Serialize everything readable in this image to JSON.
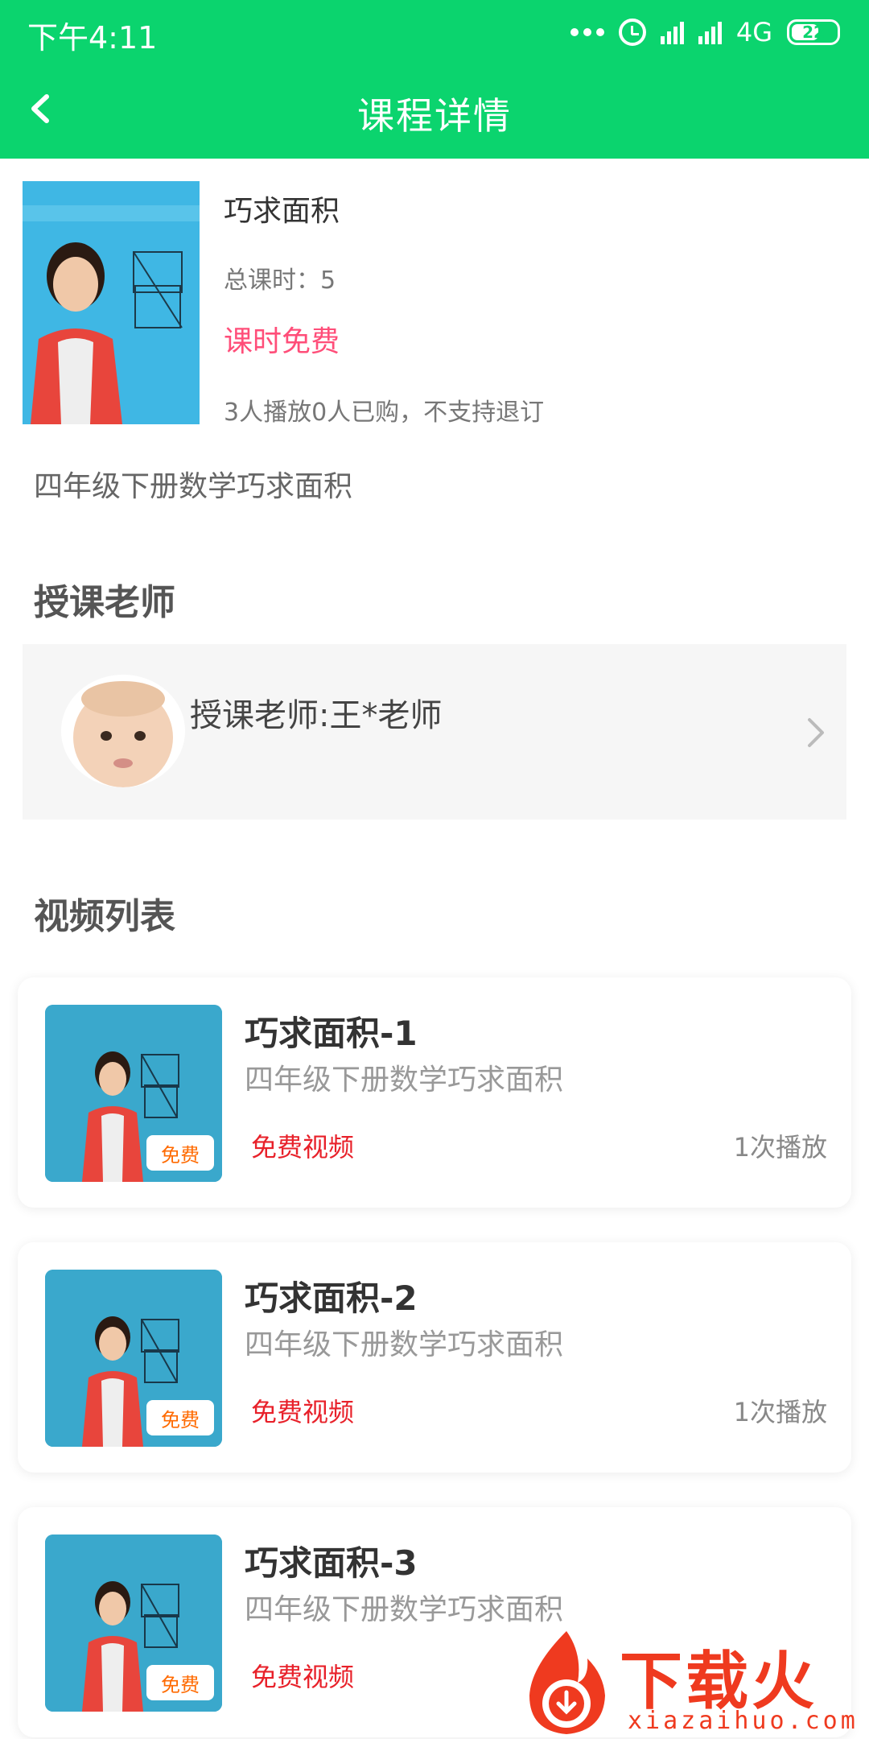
{
  "status_bar": {
    "time": "下午4:11",
    "network": "4G",
    "battery": "22",
    "icons": [
      "more-dots-icon",
      "alarm-icon",
      "signal-icon",
      "signal-icon",
      "battery-icon"
    ]
  },
  "header": {
    "title": "课程详情",
    "back_icon": "back-arrow-icon",
    "background_color": "#0bd46e"
  },
  "course": {
    "name": "巧求面积",
    "total_lessons": "总课时：5",
    "price_label": "课时免费",
    "sales_info": "3人播放0人已购，不支持退订",
    "description": "四年级下册数学巧求面积",
    "price_color": "#ff4e79"
  },
  "teacher_section": {
    "title": "授课老师",
    "teacher_label": "授课老师:王*老师",
    "chevron_icon": "chevron-right-icon"
  },
  "video_section": {
    "title": "视频列表",
    "videos": [
      {
        "title": "巧求面积-1",
        "subtitle": "四年级下册数学巧求面积",
        "badge": "免费",
        "free_label": "免费视频",
        "plays": "1次播放"
      },
      {
        "title": "巧求面积-2",
        "subtitle": "四年级下册数学巧求面积",
        "badge": "免费",
        "free_label": "免费视频",
        "plays": "1次播放"
      },
      {
        "title": "巧求面积-3",
        "subtitle": "四年级下册数学巧求面积",
        "badge": "免费",
        "free_label": "免费视频",
        "plays": ""
      }
    ]
  },
  "watermark": {
    "text": "下载火",
    "sub": "xiazaihuo.com"
  }
}
